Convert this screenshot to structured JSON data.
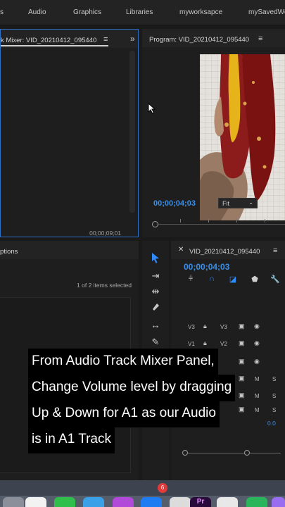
{
  "workspace_tabs": [
    "s",
    "Audio",
    "Graphics",
    "Libraries",
    "myworksapce",
    "mySavedWo"
  ],
  "mixer_panel": {
    "title": "k Mixer: VID_20210412_095440",
    "menu_icon": "hamburger-menu-icon",
    "overflow_icon": "double-chevron-right-icon",
    "timecode": "00;00;09;01"
  },
  "program_panel": {
    "title": "Program: VID_20210412_095440",
    "menu_icon": "hamburger-menu-icon",
    "timecode": "00;00;04;03",
    "zoom": "Fit"
  },
  "project_panel": {
    "title": "ptions",
    "items_selected": "1 of 2 items selected"
  },
  "timeline_panel": {
    "title": "VID_20210412_095440",
    "timecode": "00;00;04;03",
    "tracks": [
      {
        "left": "V3",
        "right": "V3"
      },
      {
        "left": "V1",
        "right": "V2"
      }
    ],
    "mute_label": "M",
    "solo_label": "S",
    "audio_level": "0.0"
  },
  "caption": {
    "lines": [
      "From Audio Track Mixer Panel,",
      "Change Volume level by dragging",
      "Up & Down for A1 as our Audio",
      "is in A1 Track"
    ]
  },
  "dock": {
    "badge_count": "6",
    "premiere_label": "Pr"
  },
  "colors": {
    "accent_blue": "#3a8ee6",
    "panel_bg": "#1e1e1e",
    "active_border": "#2f6ec5"
  }
}
